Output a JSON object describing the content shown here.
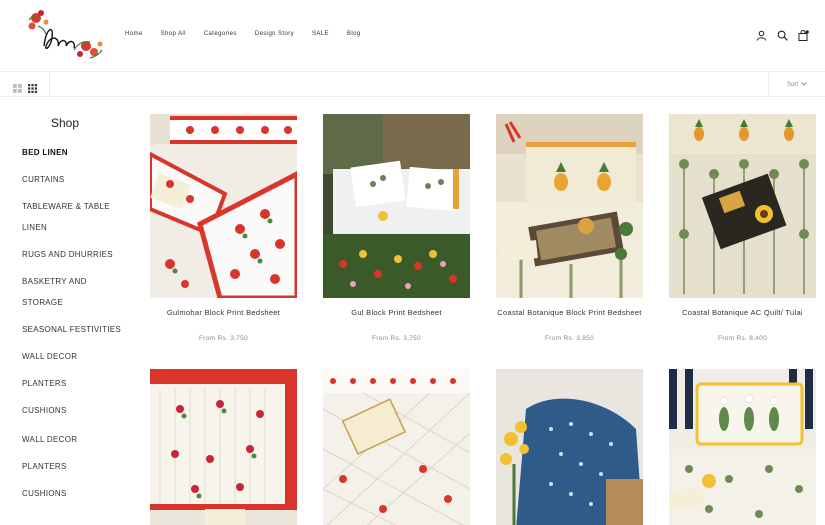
{
  "header": {
    "nav": [
      "Home",
      "Shop All",
      "Categories",
      "Design Story",
      "SALE",
      "Blog"
    ],
    "icons": [
      "account-icon",
      "search-icon",
      "cart-icon"
    ]
  },
  "toolbar": {
    "sort_label": "Sort"
  },
  "sidebar": {
    "title": "Shop",
    "items": [
      {
        "label": "BED LINEN",
        "active": true
      },
      {
        "label": "CURTAINS"
      },
      {
        "label": "TABLEWARE & TABLE"
      },
      {
        "label": "LINEN"
      },
      {
        "label": "RUGS AND DHURRIES"
      },
      {
        "label": "BASKETRY AND"
      },
      {
        "label": "STORAGE"
      },
      {
        "label": "SEASONAL FESTIVITIES"
      },
      {
        "label": "WALL DECOR"
      },
      {
        "label": "PLANTERS"
      },
      {
        "label": "CUSHIONS"
      },
      {
        "label": "WALL DECOR"
      },
      {
        "label": "PLANTERS"
      },
      {
        "label": "CUSHIONS"
      }
    ]
  },
  "products": [
    {
      "name": "Gulmohar Block Print Bedsheet",
      "price": "From Rs. 3,750"
    },
    {
      "name": "Gul Block Print Bedsheet",
      "price": "From Rs. 3,750"
    },
    {
      "name": "Coastal Botanique Block Print Bedsheet",
      "price": "From Rs. 3,850"
    },
    {
      "name": "Coastal Botanique AC Quilt/ Tulai",
      "price": "From Rs. 8,400"
    }
  ]
}
